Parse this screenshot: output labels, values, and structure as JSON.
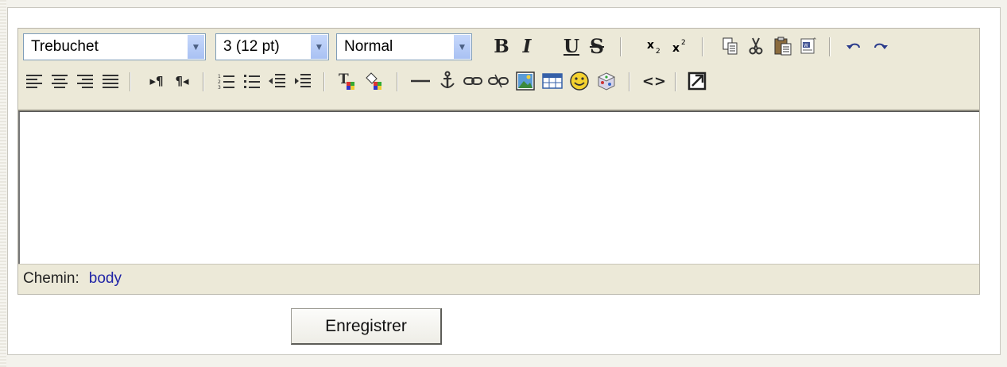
{
  "toolbar": {
    "font_family": "Trebuchet",
    "font_size": "3 (12 pt)",
    "paragraph_format": "Normal",
    "bold_label": "B",
    "italic_label": "I",
    "underline_label": "U",
    "strike_label": "S",
    "html_source_label": "<>"
  },
  "icons": [
    "bold-icon",
    "italic-icon",
    "underline-icon",
    "strikethrough-icon",
    "subscript-icon",
    "superscript-icon",
    "copy-icon",
    "cut-icon",
    "paste-icon",
    "paste-word-icon",
    "undo-icon",
    "redo-icon",
    "align-left-icon",
    "align-center-icon",
    "align-right-icon",
    "justify-icon",
    "ltr-icon",
    "rtl-icon",
    "ordered-list-icon",
    "unordered-list-icon",
    "outdent-icon",
    "indent-icon",
    "text-color-icon",
    "highlight-color-icon",
    "horizontal-rule-icon",
    "anchor-icon",
    "link-icon",
    "unlink-icon",
    "image-icon",
    "table-icon",
    "smiley-icon",
    "special-char-icon",
    "html-source-icon",
    "fullscreen-icon"
  ],
  "status": {
    "path_label": "Chemin:",
    "path_value": "body"
  },
  "save_label": "Enregistrer",
  "colors": {
    "toolbar_bg": "#ece9d8",
    "select_border": "#7f9db9",
    "path_link": "#2125a6"
  }
}
